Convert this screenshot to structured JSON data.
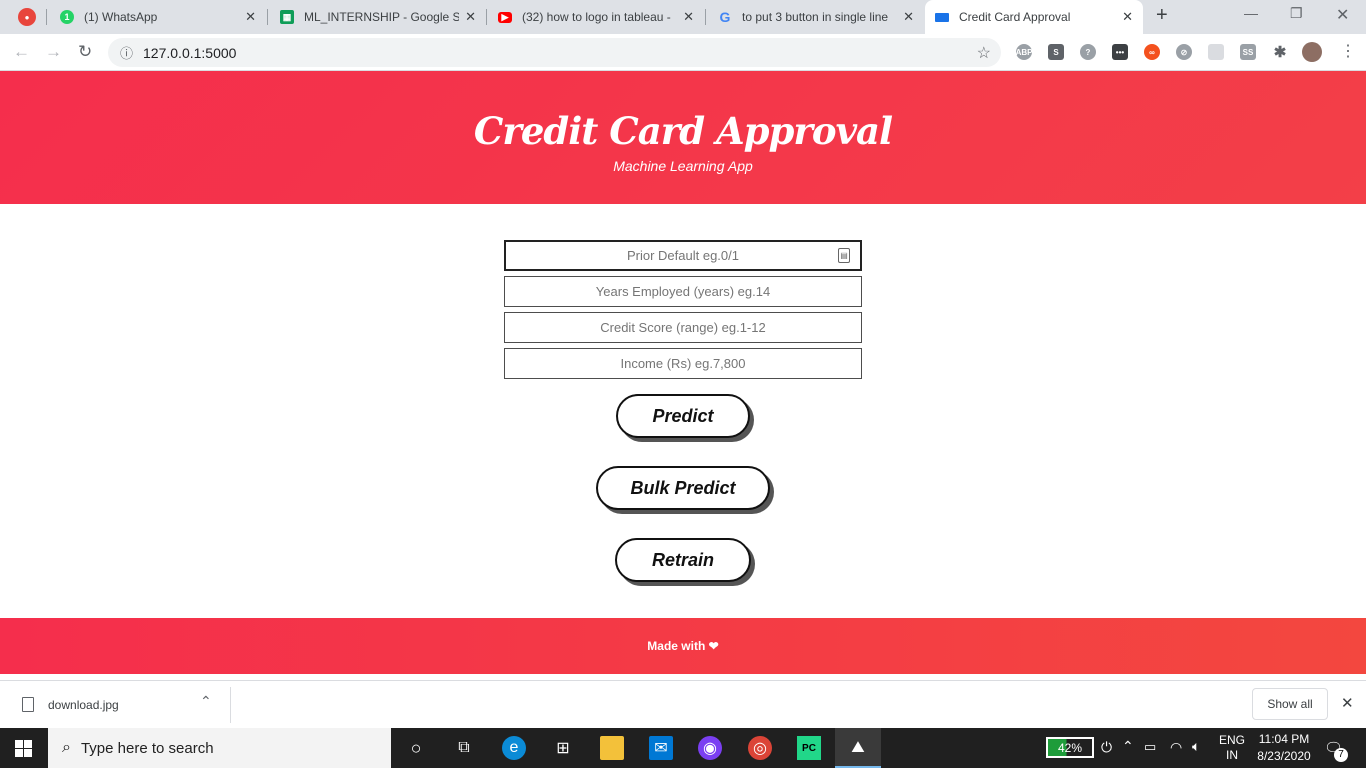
{
  "browser": {
    "tabs": [
      {
        "title": "(1) WhatsApp",
        "favicon_color": "#25d366"
      },
      {
        "title": "ML_INTERNSHIP - Google Sh",
        "favicon_color": "#0f9d58"
      },
      {
        "title": "(32) how to logo in tableau -",
        "favicon_color": "#ff0000"
      },
      {
        "title": "to put 3 button in single line",
        "favicon_color": "#4285f4"
      },
      {
        "title": "Credit Card Approval",
        "favicon_color": "#1a73e8"
      }
    ],
    "url": "127.0.0.1:5000",
    "whatsapp_badge": "1"
  },
  "page": {
    "title": "Credit Card Approval",
    "subtitle": "Machine Learning App",
    "fields": [
      {
        "placeholder": "Prior Default eg.0/1"
      },
      {
        "placeholder": "Years Employed (years) eg.14"
      },
      {
        "placeholder": "Credit Score (range) eg.1-12"
      },
      {
        "placeholder": "Income (Rs) eg.7,800"
      }
    ],
    "buttons": {
      "predict": "Predict",
      "bulk": "Bulk Predict",
      "retrain": "Retrain"
    },
    "footer": "Made with ❤",
    "colors": {
      "accent": "#f52e4c"
    }
  },
  "downloads": {
    "file": "download.jpg",
    "show_all": "Show all"
  },
  "taskbar": {
    "search_placeholder": "Type here to search",
    "battery": "42%",
    "lang": "ENG",
    "region": "IN",
    "time": "11:04 PM",
    "date": "8/23/2020",
    "notifications": "7"
  }
}
